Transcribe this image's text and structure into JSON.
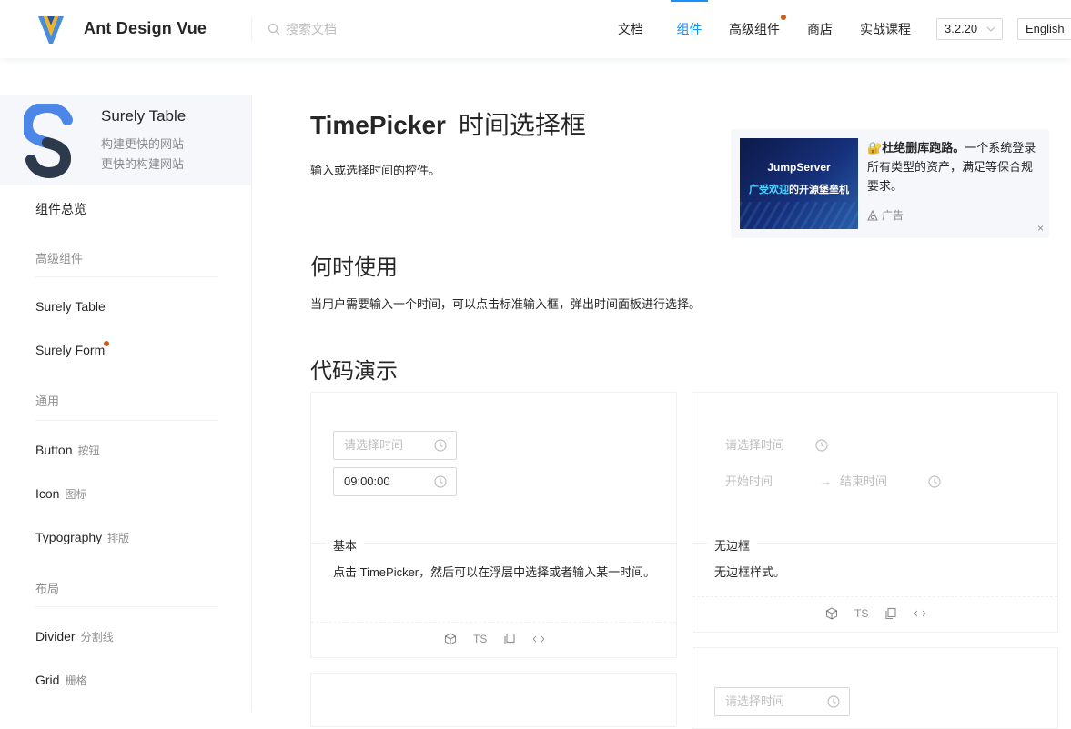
{
  "header": {
    "brand": "Ant Design Vue",
    "search_placeholder": "搜索文档",
    "nav": [
      {
        "label": "文档"
      },
      {
        "label": "组件"
      },
      {
        "label": "高级组件"
      },
      {
        "label": "商店"
      },
      {
        "label": "实战课程"
      }
    ],
    "version": "3.2.20",
    "language": "English"
  },
  "sidebar": {
    "promo": {
      "title": "Surely Table",
      "line1": "构建更快的网站",
      "line2": "更快的构建网站"
    },
    "overview": "组件总览",
    "groups": {
      "advanced": "高级组件",
      "general": "通用",
      "layout": "布局"
    },
    "items": {
      "surely_table": "Surely Table",
      "surely_form": "Surely Form",
      "button": "Button",
      "button_sub": "按钮",
      "icon": "Icon",
      "icon_sub": "图标",
      "typography": "Typography",
      "typography_sub": "排版",
      "divider": "Divider",
      "divider_sub": "分割线",
      "grid": "Grid",
      "grid_sub": "栅格"
    }
  },
  "main": {
    "title_en": "TimePicker",
    "title_cn": "时间选择框",
    "lead": "输入或选择时间的控件。",
    "when_title": "何时使用",
    "when_text": "当用户需要输入一个时间，可以点击标准输入框，弹出时间面板进行选择。",
    "demo_title": "代码演示"
  },
  "ad": {
    "img_line1": "JumpServer",
    "img_line2_hl": "广受欢迎",
    "img_line2_rest": "的开源堡垒机",
    "headline": "杜绝删库跑路。",
    "body": "一个系统登录所有类型的资产，满足等保合规要求。",
    "tag": "广告",
    "close": "×"
  },
  "demos": {
    "basic": {
      "placeholder": "请选择时间",
      "value": "09:00:00",
      "label": "基本",
      "desc": "点击 TimePicker，然后可以在浮层中选择或者输入某一时间。",
      "actions": {
        "ts": "TS"
      }
    },
    "borderless": {
      "placeholder": "请选择时间",
      "start": "开始时间",
      "end": "结束时间",
      "label": "无边框",
      "desc": "无边框样式。",
      "actions": {
        "ts": "TS"
      }
    },
    "third": {
      "placeholder": "请选择时间"
    }
  },
  "colors": {
    "primary": "#1890ff",
    "dot": "#c75a1f"
  }
}
